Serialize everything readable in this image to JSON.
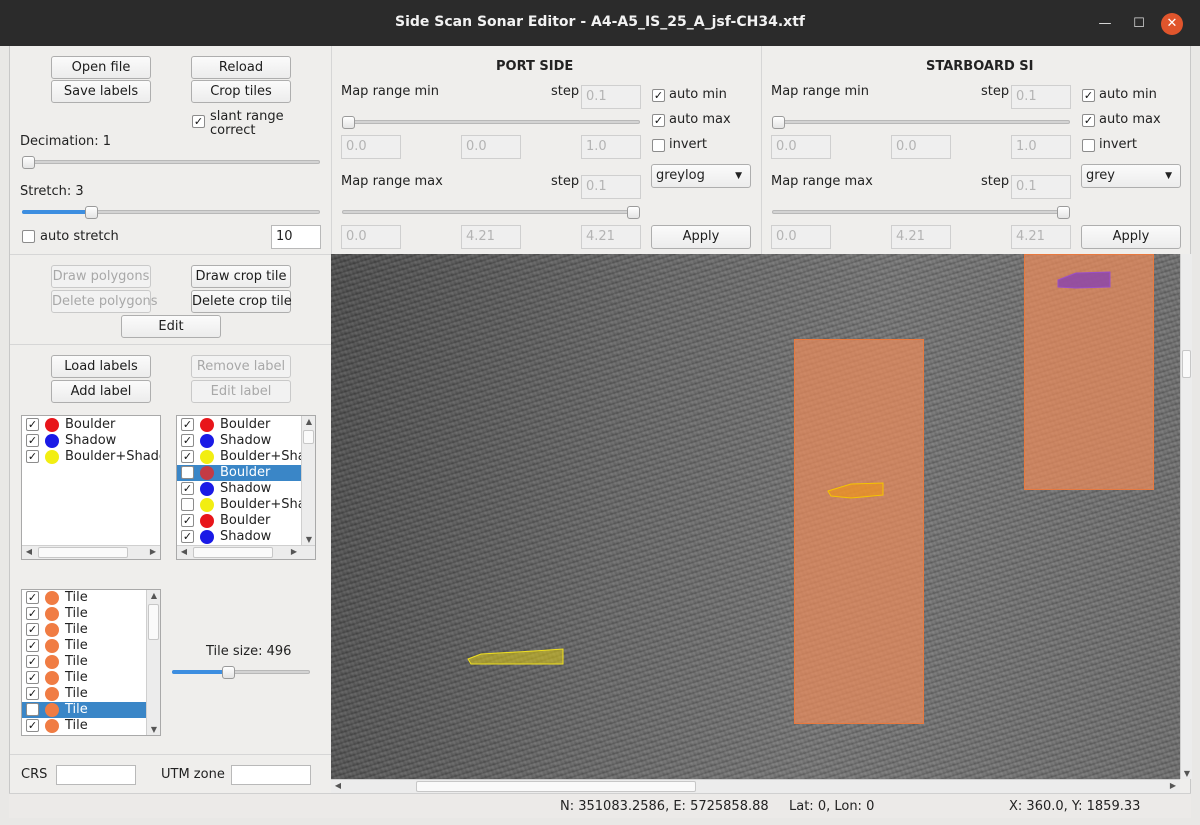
{
  "window": {
    "title": "Side Scan Sonar Editor - A4-A5_IS_25_A_jsf-CH34.xtf"
  },
  "controls": {
    "open_file": "Open file",
    "reload": "Reload",
    "save_labels": "Save labels",
    "crop_tiles": "Crop tiles",
    "slant_range_line1": "slant range",
    "slant_range_line2": "correct",
    "slant_range_checked": true,
    "decimation_label": "Decimation: 1",
    "decimation_value": 1,
    "stretch_label": "Stretch: 3",
    "stretch_value": 3,
    "auto_stretch_label": "auto stretch",
    "auto_stretch_checked": false,
    "auto_stretch_value": "10"
  },
  "port": {
    "header": "PORT SIDE",
    "map_range_min": "Map range min",
    "step_label": "step",
    "min_step": "0.1",
    "auto_min": "auto min",
    "auto_min_checked": true,
    "auto_max": "auto max",
    "auto_max_checked": true,
    "invert": "invert",
    "invert_checked": false,
    "min_fields": [
      "0.0",
      "0.0",
      "1.0"
    ],
    "colormap": "greylog",
    "map_range_max": "Map range max",
    "max_step": "0.1",
    "max_fields": [
      "0.0",
      "4.21",
      "4.21"
    ],
    "apply": "Apply"
  },
  "starboard": {
    "header": "STARBOARD SI",
    "map_range_min": "Map range min",
    "step_label": "step",
    "min_step": "0.1",
    "auto_min": "auto min",
    "auto_min_checked": true,
    "auto_max": "auto max",
    "auto_max_checked": true,
    "invert": "invert",
    "invert_checked": false,
    "min_fields": [
      "0.0",
      "0.0",
      "1.0"
    ],
    "colormap": "grey",
    "map_range_max": "Map range max",
    "max_step": "0.1",
    "max_fields": [
      "0.0",
      "4.21",
      "4.21"
    ],
    "apply": "Apply"
  },
  "polygons": {
    "draw_polygons": "Draw polygons",
    "draw_crop_tile": "Draw crop tile",
    "delete_polygons": "Delete polygons",
    "delete_crop_tile": "Delete crop tile",
    "edit": "Edit"
  },
  "labels": {
    "load_labels": "Load labels",
    "remove_label": "Remove label",
    "add_label": "Add label",
    "edit_label": "Edit label",
    "classes": [
      {
        "name": "Boulder",
        "color": "#e8151a",
        "checked": true
      },
      {
        "name": "Shadow",
        "color": "#1a1ae6",
        "checked": true
      },
      {
        "name": "Boulder+Shadow",
        "color": "#f2ee12",
        "checked": true
      }
    ],
    "instances": [
      {
        "name": "Boulder",
        "color": "#e8151a",
        "checked": true,
        "selected": false
      },
      {
        "name": "Shadow",
        "color": "#1a1ae6",
        "checked": true,
        "selected": false
      },
      {
        "name": "Boulder+Shadow",
        "color": "#f2ee12",
        "checked": true,
        "selected": false
      },
      {
        "name": "Boulder",
        "color": "#c43b45",
        "checked": false,
        "selected": true
      },
      {
        "name": "Shadow",
        "color": "#1a1ae6",
        "checked": true,
        "selected": false
      },
      {
        "name": "Boulder+Shadow",
        "color": "#f2ee12",
        "checked": false,
        "selected": false
      },
      {
        "name": "Boulder",
        "color": "#e8151a",
        "checked": true,
        "selected": false
      },
      {
        "name": "Shadow",
        "color": "#1a1ae6",
        "checked": true,
        "selected": false
      }
    ]
  },
  "tiles": {
    "items": [
      {
        "name": "Tile",
        "checked": true,
        "selected": false
      },
      {
        "name": "Tile",
        "checked": true,
        "selected": false
      },
      {
        "name": "Tile",
        "checked": true,
        "selected": false
      },
      {
        "name": "Tile",
        "checked": true,
        "selected": false
      },
      {
        "name": "Tile",
        "checked": true,
        "selected": false
      },
      {
        "name": "Tile",
        "checked": true,
        "selected": false
      },
      {
        "name": "Tile",
        "checked": true,
        "selected": false
      },
      {
        "name": "Tile",
        "checked": false,
        "selected": true
      },
      {
        "name": "Tile",
        "checked": true,
        "selected": false
      }
    ],
    "tile_color": "#f07c43",
    "tile_size_label": "Tile size: 496",
    "tile_size": 496
  },
  "geo": {
    "crs_label": "CRS",
    "crs_value": "",
    "utm_label": "UTM zone",
    "utm_value": ""
  },
  "status": {
    "northing_easting": "N:  351083.2586, E:  5725858.88",
    "lat_lon": "Lat: 0, Lon: 0",
    "xy": "X: 360.0, Y: 1859.33"
  }
}
